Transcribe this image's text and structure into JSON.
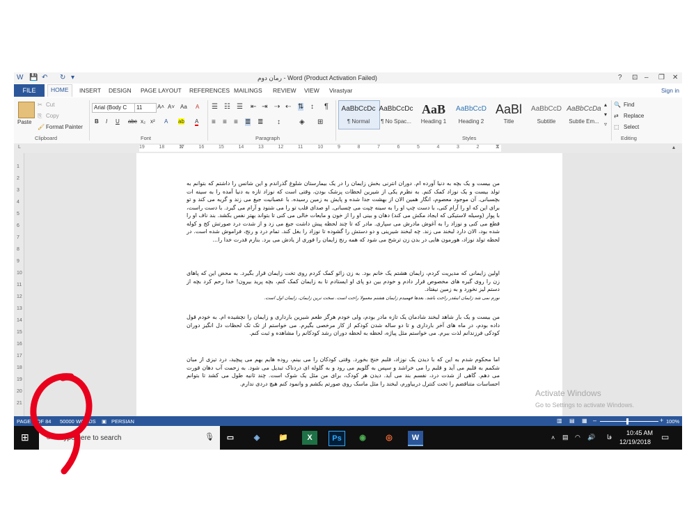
{
  "window": {
    "title": "رمان دوم - Word (Product Activation Failed)",
    "help": "?",
    "ribbon_opts": "⊡",
    "minimize": "–",
    "restore": "❐",
    "close": "✕"
  },
  "qat": {
    "word_icon": "W",
    "save": "💾",
    "undo": "↶",
    "redo": "↻",
    "more": "▾"
  },
  "tabs": {
    "file": "FILE",
    "home": "HOME",
    "insert": "INSERT",
    "design": "DESIGN",
    "layout": "PAGE LAYOUT",
    "references": "REFERENCES",
    "mailings": "MAILINGS",
    "review": "REVIEW",
    "view": "VIEW",
    "virastyar": "Virastyar",
    "signin": "Sign in"
  },
  "clipboard": {
    "paste": "Paste",
    "cut": "Cut",
    "copy": "Copy",
    "format_painter": "Format Painter",
    "label": "Clipboard"
  },
  "font": {
    "name": "Arial (Body C",
    "size": "11",
    "grow": "A˄",
    "shrink": "A˅",
    "case": "Aa",
    "clear": "A",
    "bold": "B",
    "italic": "I",
    "underline": "U",
    "strike": "abc",
    "sub": "x₂",
    "sup": "x²",
    "effects": "A",
    "highlight": "ab",
    "color": "A",
    "label": "Font"
  },
  "paragraph": {
    "pilcrow": "¶",
    "label": "Paragraph"
  },
  "styles": {
    "label": "Styles",
    "items": [
      {
        "sample": "AaBbCcDc",
        "name": "¶ Normal"
      },
      {
        "sample": "AaBbCcDc",
        "name": "¶ No Spac..."
      },
      {
        "sample": "AaB",
        "name": "Heading 1"
      },
      {
        "sample": "AaBbCcD",
        "name": "Heading 2"
      },
      {
        "sample": "AaBl",
        "name": "Title"
      },
      {
        "sample": "AaBbCcD",
        "name": "Subtitle"
      },
      {
        "sample": "AaBbCcDa",
        "name": "Subtle Em..."
      }
    ]
  },
  "editing": {
    "find": "Find",
    "replace": "Replace",
    "select": "Select",
    "label": "Editing"
  },
  "ruler": {
    "numbers": [
      "19",
      "18",
      "17",
      "16",
      "15",
      "14",
      "13",
      "12",
      "11",
      "10",
      "9",
      "8",
      "7",
      "6",
      "5",
      "4",
      "3",
      "2",
      "1"
    ],
    "left_mark": "L",
    "vnums": [
      "1",
      "2",
      "3",
      "4",
      "5",
      "6",
      "7",
      "8",
      "9",
      "10",
      "11",
      "12",
      "13",
      "14",
      "15",
      "16",
      "17",
      "18",
      "19",
      "20",
      "21"
    ]
  },
  "document": {
    "paragraphs": [
      "من بیست و یک بچه به دنیا آورده ام. دوران انترنی بخش زایمان را در یک بیمارستان شلوغ گذراندم و این شانس را داشتم که بتوانم به تولد بیست و یک نوزاد کمک کنم. به نظرم یکی از شیرین لحظات پزشک بودن، وقتی است که نوزاد تازه به دنیا آمده را به سینه ات بچسبانی. آن موجود معصوم، انگار همین الان از بهشت جدا شده و پایش به زمین رسیده. با عصبانیت جیغ می زند و گریه می کند و تو برای این که او را آرام کنی، با دست چپ او را به سینه چپت می چسبانی. او صدای قلب تو را می شنود و آرام می گیرد. با دست راست، با پوار (وسیله لاستیکی که ایجاد مکش می کند) دهان و بینی او را از خون و مایعات خالی می کنی تا بتواند بهتر نفس بکشد. بند ناف او را قطع می کنی و نوزاد را به آغوش مادرش می سپاری. مادر که تا چند لحظه پیش داشت جیغ می زد و از شدت درد صورتش کج و کوله شده بود، الان دارد لبخند می زند. چه لبخند شیرینی و دو دستش را گشوده تا نوزاد را بغل کند. تمام درد و رنج، فراموش شده است. در لحظه تولد نوزاد، هورمون هایی در بدن زن ترشح می شود که همه رنج زایمان را فوری از یادش می برد. بنازم قدرت خدا را...",
      "اولین زایمانی که مدیریت کردم، زایمان هشتم یک خانم بود. به زن زائو کمک کردم روی تخت زایمان قرار بگیرد. به محض این که پاهای زن را روی گیره های مخصوص قرار دادم و خودم بین دو پای او ایستادم تا به زایمان کمک کنم، بچه پرید بیرون! خدا رحم کرد بچه از دستم لیز نخورد و به زمین نیفتاد.",
      "نورم نمی شد زایمان اینقدر راحت باشد. بعدها فهمیدم زایمان هشتم معمولا راحت است. سخت ترین زایمان، زایمان اول است.",
      "من بیست و یک بار شاهد لبخند شادمان یک تازه مادر بودم، ولی خودم هرگز طعم شیرین بارداری و زایمان را نچشیده ام. به خودم قول داده بودم، در ماه های آخر بارداری و تا دو ساله شدن کودکم از کار مرخصی بگیرم. می خواستم از تک تک لحظات دل انگیز دوران کودکی فرزندانم لذت ببرم. می خواستم مثل پیاژه، لحظه به لحظه دوران رشد کودکانم را مشاهده و ثبت کنم.",
      "اما محکوم شدم به این که با دیدن یک نوزاد، قلبم خنج بخورد. وقتی کودکان را می بینم، روده هایم بهم می پیچید، درد تیزی از میان شکمم به قلبم می آید و قلبم را می خراشد و سپس به گلویم می رود و به گلوله ای دردناک تبدیل می شود. به زحمت آب دهان قورت می دهم. گاهی از شدت درد، نفسم بند می آید. دیدن هر کودک، برای من مثل یک شوک است. چند ثانیه طول می کشد تا بتوانم احساسات متناقضم را تحت کنترل دربیاورم، لبخند را مثل ماسک روی صورتم بکشم و وانمود کنم هیچ دردی ندارم."
    ]
  },
  "activation": {
    "line1": "Activate Windows",
    "line2": "Go to Settings to activate Windows."
  },
  "status": {
    "page": "PAGE 1 OF 84",
    "words": "50000 WORDS",
    "lang": "PERSIAN",
    "zoom": "100%",
    "minus": "–",
    "plus": "+"
  },
  "taskbar": {
    "search_placeholder": "Type here to search",
    "time": "10:45 AM",
    "date": "12/19/2018",
    "lang": "فا",
    "apps": [
      "▭",
      "◈",
      "📁",
      "X",
      "Ps",
      "◉",
      "◎",
      "W"
    ]
  },
  "colors": {
    "accent": "#2b579a",
    "annotation": "#e8001c"
  }
}
